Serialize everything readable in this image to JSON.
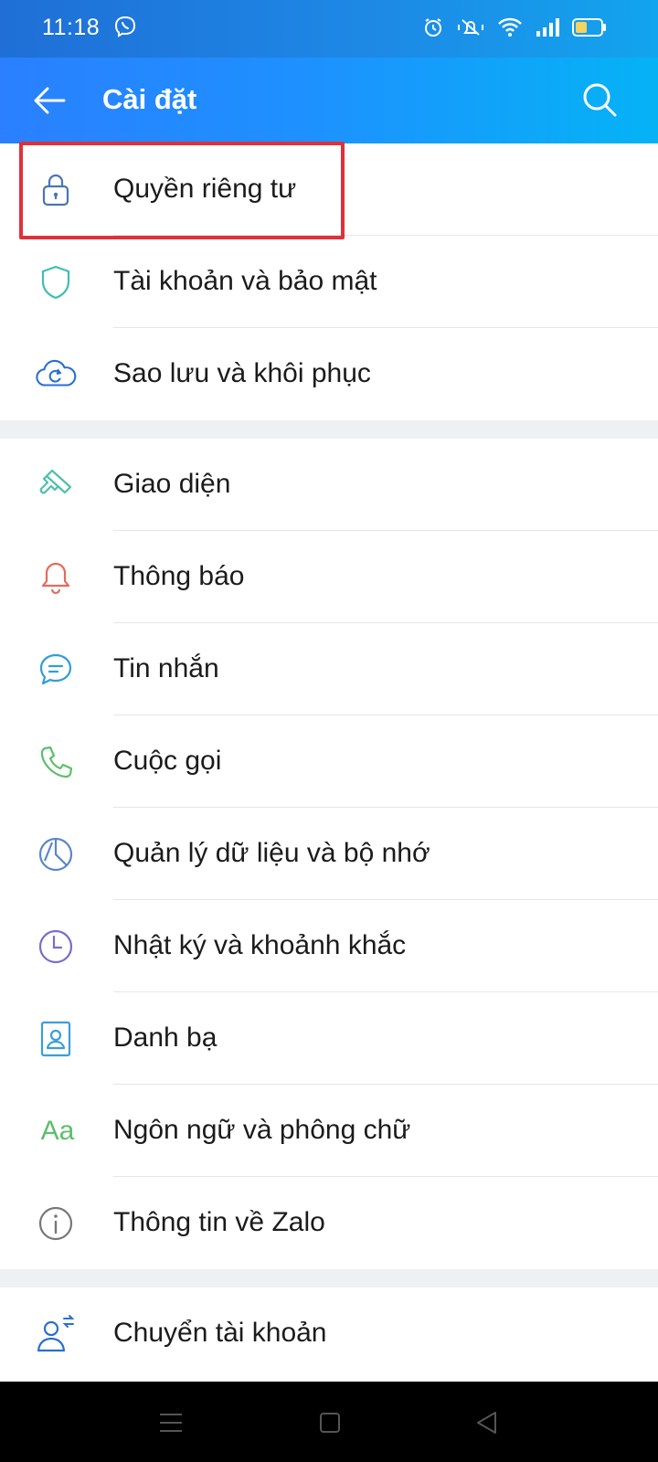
{
  "status_bar": {
    "time": "11:18",
    "icons": [
      "viber-icon",
      "alarm-icon",
      "vibrate-icon",
      "wifi-icon",
      "signal-icon",
      "battery-icon"
    ]
  },
  "app_bar": {
    "title": "Cài đặt",
    "back_icon": "arrow-left-icon",
    "search_icon": "search-icon",
    "gradient_colors": [
      "#2a80ff",
      "#05b3f5"
    ]
  },
  "settings": {
    "groups": [
      {
        "items": [
          {
            "label": "Quyền riêng tư",
            "icon": "lock-icon",
            "color": "#4a74b8"
          },
          {
            "label": "Tài khoản và bảo mật",
            "icon": "shield-icon",
            "color": "#3fbfb0"
          },
          {
            "label": "Sao lưu và khôi phục",
            "icon": "cloud-sync-icon",
            "color": "#2a6fd0"
          }
        ]
      },
      {
        "items": [
          {
            "label": "Giao diện",
            "icon": "paint-brush-icon",
            "color": "#4cc2a8"
          },
          {
            "label": "Thông báo",
            "icon": "bell-icon",
            "color": "#e56a5a"
          },
          {
            "label": "Tin nhắn",
            "icon": "chat-icon",
            "color": "#2f9ed8"
          },
          {
            "label": "Cuộc gọi",
            "icon": "phone-icon",
            "color": "#5cbf6a"
          },
          {
            "label": "Quản lý dữ liệu và bộ nhớ",
            "icon": "pie-chart-icon",
            "color": "#5b86c9"
          },
          {
            "label": "Nhật ký và khoảnh khắc",
            "icon": "clock-icon",
            "color": "#7b6cc9"
          },
          {
            "label": "Danh bạ",
            "icon": "contact-card-icon",
            "color": "#3a9ed8"
          },
          {
            "label": "Ngôn ngữ và phông chữ",
            "icon": "font-icon",
            "icon_text": "Aa",
            "color": "#5cbf6a"
          },
          {
            "label": "Thông tin về Zalo",
            "icon": "info-icon",
            "color": "#777777"
          }
        ]
      },
      {
        "items": [
          {
            "label": "Chuyển tài khoản",
            "icon": "switch-account-icon",
            "color": "#2a6fd0"
          }
        ]
      }
    ],
    "highlight_color": "#e0303a"
  },
  "nav_bar": {
    "icons": [
      "menu-icon",
      "home-square-icon",
      "back-triangle-icon"
    ]
  }
}
